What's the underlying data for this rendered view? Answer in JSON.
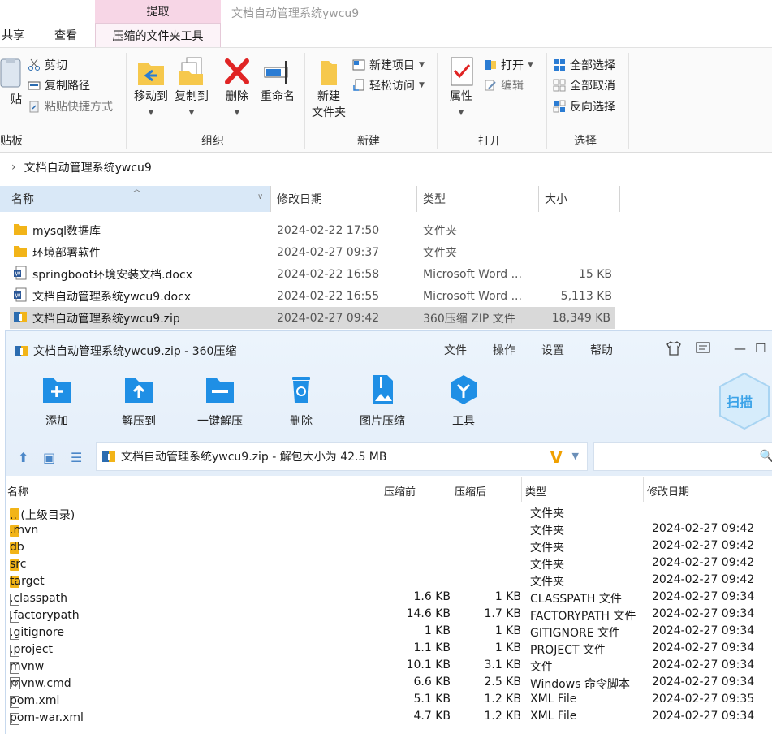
{
  "explorer": {
    "context_tab": "提取",
    "window_title": "文档自动管理系统ywcu9",
    "tabs": [
      "共享",
      "查看",
      "压缩的文件夹工具"
    ],
    "ribbon": {
      "clipboard": {
        "cut": "剪切",
        "copy_path": "复制路径",
        "paste_shortcut": "粘贴快捷方式",
        "paste_partial": "贴",
        "group_label": "贴板"
      },
      "organize": {
        "move_to": "移动到",
        "copy_to": "复制到",
        "delete": "删除",
        "rename": "重命名",
        "group_label": "组织"
      },
      "new": {
        "new_folder_line1": "新建",
        "new_folder_line2": "文件夹",
        "new_item": "新建项目",
        "easy_access": "轻松访问",
        "group_label": "新建"
      },
      "open": {
        "properties": "属性",
        "open": "打开",
        "edit": "编辑",
        "group_label": "打开"
      },
      "select": {
        "select_all": "全部选择",
        "select_none": "全部取消",
        "invert": "反向选择",
        "group_label": "选择"
      }
    },
    "address": "文档自动管理系统ywcu9",
    "columns": {
      "name": "名称",
      "date": "修改日期",
      "type": "类型",
      "size": "大小"
    },
    "files": [
      {
        "name": "mysql数据库",
        "date": "2024-02-22 17:50",
        "type": "文件夹",
        "size": "",
        "icon": "folder-icon"
      },
      {
        "name": "环境部署软件",
        "date": "2024-02-27 09:37",
        "type": "文件夹",
        "size": "",
        "icon": "folder-icon"
      },
      {
        "name": "springboot环境安装文档.docx",
        "date": "2024-02-22 16:58",
        "type": "Microsoft Word ...",
        "size": "15 KB",
        "icon": "word-doc-icon"
      },
      {
        "name": "文档自动管理系统ywcu9.docx",
        "date": "2024-02-22 16:55",
        "type": "Microsoft Word ...",
        "size": "5,113 KB",
        "icon": "word-doc-icon"
      },
      {
        "name": "文档自动管理系统ywcu9.zip",
        "date": "2024-02-27 09:42",
        "type": "360压缩 ZIP 文件",
        "size": "18,349 KB",
        "icon": "zip-archive-icon",
        "selected": true
      }
    ]
  },
  "zip360": {
    "title": "文档自动管理系统ywcu9.zip - 360压缩",
    "menu": [
      "文件",
      "操作",
      "设置",
      "帮助"
    ],
    "toolbar": [
      "添加",
      "解压到",
      "一键解压",
      "删除",
      "图片压缩",
      "工具"
    ],
    "scan_label": "扫描",
    "path": "文档自动管理系统ywcu9.zip - 解包大小为 42.5 MB",
    "columns": {
      "name": "名称",
      "before": "压缩前",
      "after": "压缩后",
      "type": "类型",
      "date": "修改日期"
    },
    "rows": [
      {
        "name": ".. (上级目录)",
        "before": "",
        "after": "",
        "type": "文件夹",
        "date": "",
        "icon": "folder-icon"
      },
      {
        "name": ".mvn",
        "before": "",
        "after": "",
        "type": "文件夹",
        "date": "2024-02-27 09:42",
        "icon": "folder-icon"
      },
      {
        "name": "db",
        "before": "",
        "after": "",
        "type": "文件夹",
        "date": "2024-02-27 09:42",
        "icon": "folder-icon"
      },
      {
        "name": "src",
        "before": "",
        "after": "",
        "type": "文件夹",
        "date": "2024-02-27 09:42",
        "icon": "folder-icon"
      },
      {
        "name": "target",
        "before": "",
        "after": "",
        "type": "文件夹",
        "date": "2024-02-27 09:42",
        "icon": "folder-icon"
      },
      {
        "name": ".classpath",
        "before": "1.6 KB",
        "after": "1 KB",
        "type": "CLASSPATH 文件",
        "date": "2024-02-27 09:34",
        "icon": "file-icon"
      },
      {
        "name": ".factorypath",
        "before": "14.6 KB",
        "after": "1.7 KB",
        "type": "FACTORYPATH 文件",
        "date": "2024-02-27 09:34",
        "icon": "file-icon"
      },
      {
        "name": ".gitignore",
        "before": "1 KB",
        "after": "1 KB",
        "type": "GITIGNORE 文件",
        "date": "2024-02-27 09:34",
        "icon": "file-icon"
      },
      {
        "name": ".project",
        "before": "1.1 KB",
        "after": "1 KB",
        "type": "PROJECT 文件",
        "date": "2024-02-27 09:34",
        "icon": "file-icon"
      },
      {
        "name": "mvnw",
        "before": "10.1 KB",
        "after": "3.1 KB",
        "type": "文件",
        "date": "2024-02-27 09:34",
        "icon": "file-icon"
      },
      {
        "name": "mvnw.cmd",
        "before": "6.6 KB",
        "after": "2.5 KB",
        "type": "Windows 命令脚本",
        "date": "2024-02-27 09:34",
        "icon": "cmd-script-icon"
      },
      {
        "name": "pom.xml",
        "before": "5.1 KB",
        "after": "1.2 KB",
        "type": "XML File",
        "date": "2024-02-27 09:35",
        "icon": "file-icon"
      },
      {
        "name": "pom-war.xml",
        "before": "4.7 KB",
        "after": "1.2 KB",
        "type": "XML File",
        "date": "2024-02-27 09:34",
        "icon": "file-icon"
      }
    ]
  },
  "colors": {
    "accent_blue": "#2b7cd3",
    "folder_yellow": "#f2b418",
    "context_tab_pink": "#f7d6e6",
    "header_blue": "#d9e8f7"
  }
}
